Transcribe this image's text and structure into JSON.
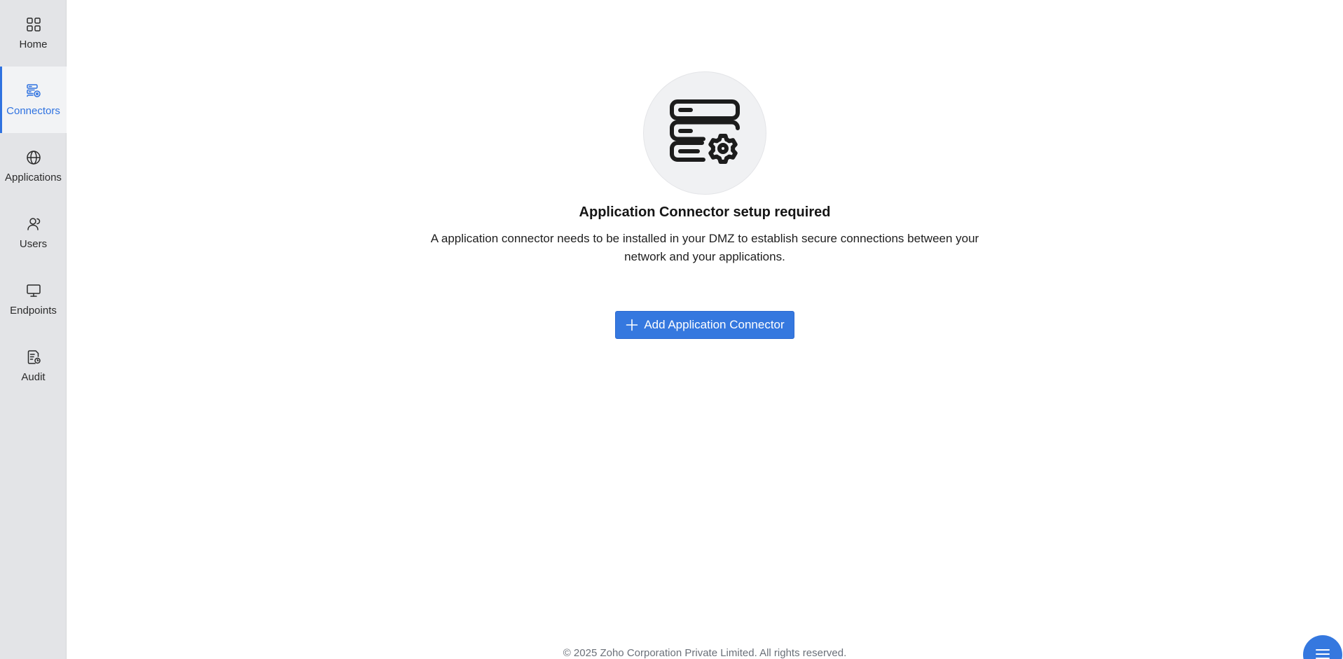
{
  "sidebar": {
    "items": [
      {
        "label": "Home",
        "icon": "home-grid-icon"
      },
      {
        "label": "Connectors",
        "icon": "connectors-icon",
        "active": true
      },
      {
        "label": "Applications",
        "icon": "globe-icon"
      },
      {
        "label": "Users",
        "icon": "user-icon"
      },
      {
        "label": "Endpoints",
        "icon": "monitor-icon"
      },
      {
        "label": "Audit",
        "icon": "audit-report-icon"
      }
    ]
  },
  "empty_state": {
    "icon": "server-gear-icon",
    "title": "Application Connector setup required",
    "description": "A application connector needs to be installed in your DMZ to establish secure connections between your network and your applications.",
    "button_label": "Add Application Connector"
  },
  "footer": {
    "copyright": "© 2025 Zoho Corporation Private Limited. All rights reserved."
  },
  "colors": {
    "accent": "#3578df",
    "sidebar_bg": "#e3e4e7",
    "active_text": "#2f72e0"
  }
}
